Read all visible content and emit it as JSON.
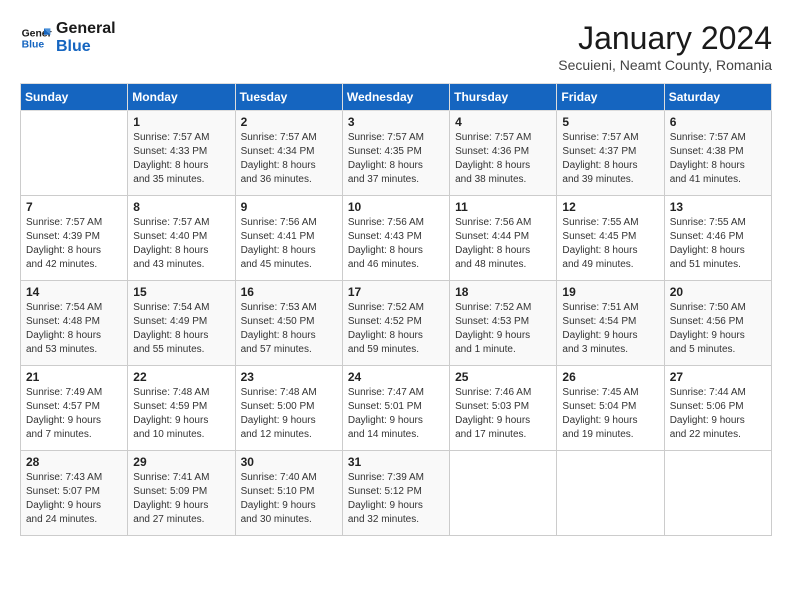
{
  "header": {
    "logo_line1": "General",
    "logo_line2": "Blue",
    "month_year": "January 2024",
    "location": "Secuieni, Neamt County, Romania"
  },
  "days_of_week": [
    "Sunday",
    "Monday",
    "Tuesday",
    "Wednesday",
    "Thursday",
    "Friday",
    "Saturday"
  ],
  "weeks": [
    [
      {
        "day": "",
        "info": ""
      },
      {
        "day": "1",
        "info": "Sunrise: 7:57 AM\nSunset: 4:33 PM\nDaylight: 8 hours\nand 35 minutes."
      },
      {
        "day": "2",
        "info": "Sunrise: 7:57 AM\nSunset: 4:34 PM\nDaylight: 8 hours\nand 36 minutes."
      },
      {
        "day": "3",
        "info": "Sunrise: 7:57 AM\nSunset: 4:35 PM\nDaylight: 8 hours\nand 37 minutes."
      },
      {
        "day": "4",
        "info": "Sunrise: 7:57 AM\nSunset: 4:36 PM\nDaylight: 8 hours\nand 38 minutes."
      },
      {
        "day": "5",
        "info": "Sunrise: 7:57 AM\nSunset: 4:37 PM\nDaylight: 8 hours\nand 39 minutes."
      },
      {
        "day": "6",
        "info": "Sunrise: 7:57 AM\nSunset: 4:38 PM\nDaylight: 8 hours\nand 41 minutes."
      }
    ],
    [
      {
        "day": "7",
        "info": "Sunrise: 7:57 AM\nSunset: 4:39 PM\nDaylight: 8 hours\nand 42 minutes."
      },
      {
        "day": "8",
        "info": "Sunrise: 7:57 AM\nSunset: 4:40 PM\nDaylight: 8 hours\nand 43 minutes."
      },
      {
        "day": "9",
        "info": "Sunrise: 7:56 AM\nSunset: 4:41 PM\nDaylight: 8 hours\nand 45 minutes."
      },
      {
        "day": "10",
        "info": "Sunrise: 7:56 AM\nSunset: 4:43 PM\nDaylight: 8 hours\nand 46 minutes."
      },
      {
        "day": "11",
        "info": "Sunrise: 7:56 AM\nSunset: 4:44 PM\nDaylight: 8 hours\nand 48 minutes."
      },
      {
        "day": "12",
        "info": "Sunrise: 7:55 AM\nSunset: 4:45 PM\nDaylight: 8 hours\nand 49 minutes."
      },
      {
        "day": "13",
        "info": "Sunrise: 7:55 AM\nSunset: 4:46 PM\nDaylight: 8 hours\nand 51 minutes."
      }
    ],
    [
      {
        "day": "14",
        "info": "Sunrise: 7:54 AM\nSunset: 4:48 PM\nDaylight: 8 hours\nand 53 minutes."
      },
      {
        "day": "15",
        "info": "Sunrise: 7:54 AM\nSunset: 4:49 PM\nDaylight: 8 hours\nand 55 minutes."
      },
      {
        "day": "16",
        "info": "Sunrise: 7:53 AM\nSunset: 4:50 PM\nDaylight: 8 hours\nand 57 minutes."
      },
      {
        "day": "17",
        "info": "Sunrise: 7:52 AM\nSunset: 4:52 PM\nDaylight: 8 hours\nand 59 minutes."
      },
      {
        "day": "18",
        "info": "Sunrise: 7:52 AM\nSunset: 4:53 PM\nDaylight: 9 hours\nand 1 minute."
      },
      {
        "day": "19",
        "info": "Sunrise: 7:51 AM\nSunset: 4:54 PM\nDaylight: 9 hours\nand 3 minutes."
      },
      {
        "day": "20",
        "info": "Sunrise: 7:50 AM\nSunset: 4:56 PM\nDaylight: 9 hours\nand 5 minutes."
      }
    ],
    [
      {
        "day": "21",
        "info": "Sunrise: 7:49 AM\nSunset: 4:57 PM\nDaylight: 9 hours\nand 7 minutes."
      },
      {
        "day": "22",
        "info": "Sunrise: 7:48 AM\nSunset: 4:59 PM\nDaylight: 9 hours\nand 10 minutes."
      },
      {
        "day": "23",
        "info": "Sunrise: 7:48 AM\nSunset: 5:00 PM\nDaylight: 9 hours\nand 12 minutes."
      },
      {
        "day": "24",
        "info": "Sunrise: 7:47 AM\nSunset: 5:01 PM\nDaylight: 9 hours\nand 14 minutes."
      },
      {
        "day": "25",
        "info": "Sunrise: 7:46 AM\nSunset: 5:03 PM\nDaylight: 9 hours\nand 17 minutes."
      },
      {
        "day": "26",
        "info": "Sunrise: 7:45 AM\nSunset: 5:04 PM\nDaylight: 9 hours\nand 19 minutes."
      },
      {
        "day": "27",
        "info": "Sunrise: 7:44 AM\nSunset: 5:06 PM\nDaylight: 9 hours\nand 22 minutes."
      }
    ],
    [
      {
        "day": "28",
        "info": "Sunrise: 7:43 AM\nSunset: 5:07 PM\nDaylight: 9 hours\nand 24 minutes."
      },
      {
        "day": "29",
        "info": "Sunrise: 7:41 AM\nSunset: 5:09 PM\nDaylight: 9 hours\nand 27 minutes."
      },
      {
        "day": "30",
        "info": "Sunrise: 7:40 AM\nSunset: 5:10 PM\nDaylight: 9 hours\nand 30 minutes."
      },
      {
        "day": "31",
        "info": "Sunrise: 7:39 AM\nSunset: 5:12 PM\nDaylight: 9 hours\nand 32 minutes."
      },
      {
        "day": "",
        "info": ""
      },
      {
        "day": "",
        "info": ""
      },
      {
        "day": "",
        "info": ""
      }
    ]
  ]
}
